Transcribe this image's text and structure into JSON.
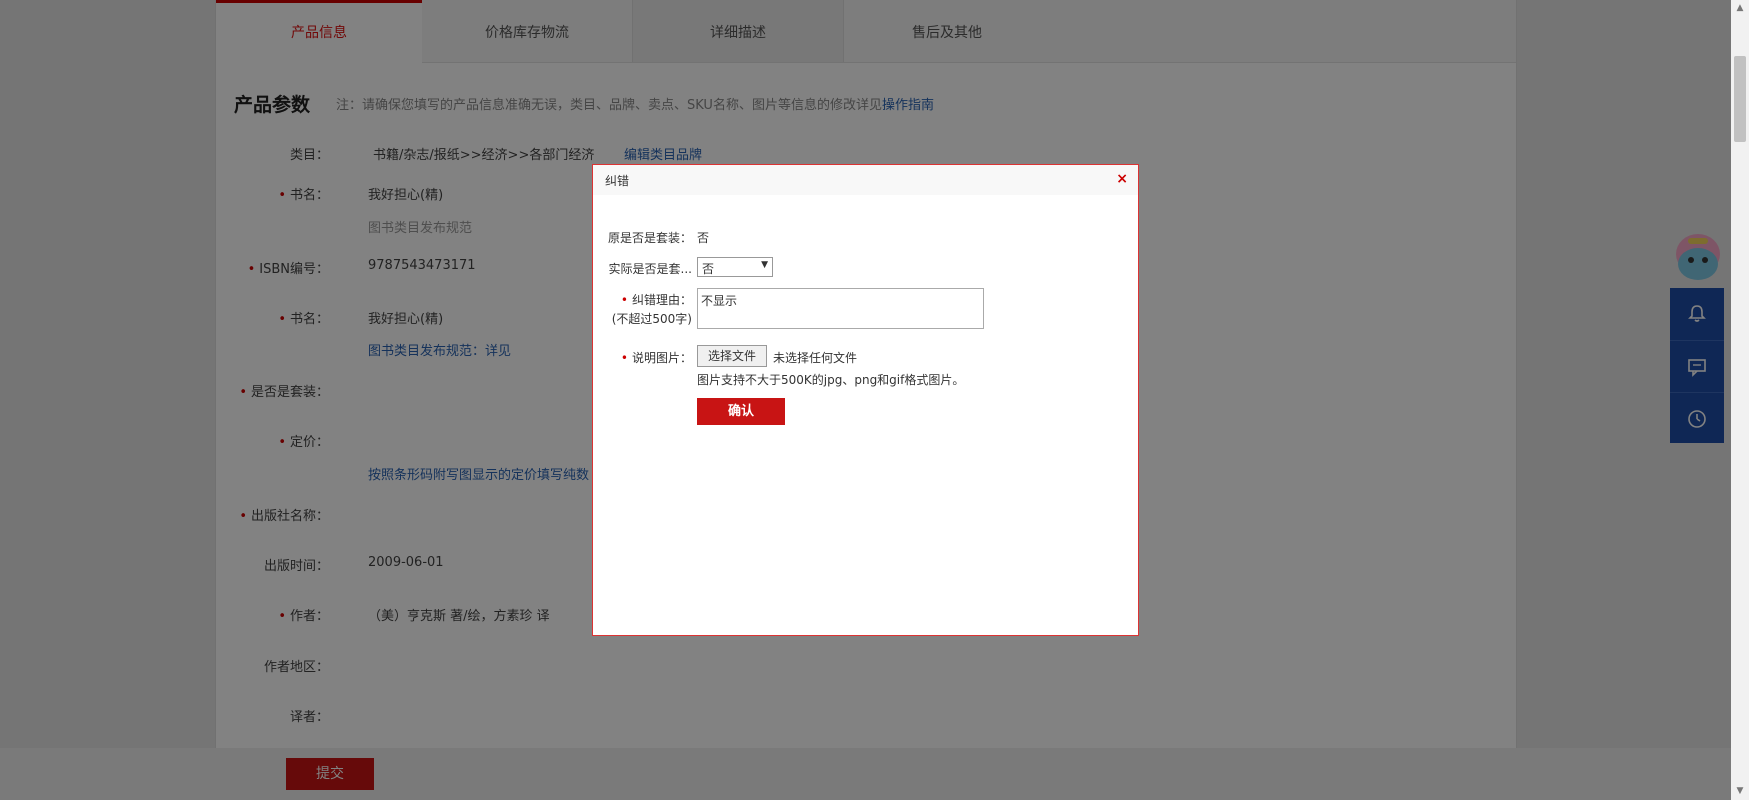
{
  "tabs": [
    {
      "label": "产品信息"
    },
    {
      "label": "价格库存物流"
    },
    {
      "label": "详细描述"
    },
    {
      "label": "售后及其他"
    }
  ],
  "section": {
    "title": "产品参数",
    "notice": "注：请确保您填写的产品信息准确无误，类目、品牌、卖点、SKU名称、图片等信息的修改详见",
    "notice_link": "操作指南"
  },
  "form": {
    "category_label": "类目：",
    "category_value": "书籍/杂志/报纸>>经济>>各部门经济",
    "category_edit_link": "编辑类目品牌",
    "bookname_label": "书名：",
    "bookname_value": "我好担心(精)",
    "bookname_hint": "图书类目发布规范",
    "isbn_label": "ISBN编号：",
    "isbn_value": "9787543473171",
    "bookname2_label": "书名：",
    "bookname2_value": "我好担心(精)",
    "bookname2_hint": "图书类目发布规范：详见",
    "is_set_label": "是否是套装：",
    "price_label": "定价：",
    "price_hint": "按照条形码附写图显示的定价填写纯数",
    "publisher_label": "出版社名称：",
    "pubdate_label": "出版时间：",
    "pubdate_value": "2009-06-01",
    "author_label": "作者：",
    "author_value": "（美）亨克斯  著/绘，方素珍  译",
    "author_region_label": "作者地区：",
    "translator_label": "译者："
  },
  "submit_label": "提交",
  "dialog": {
    "title": "纠错",
    "close": "×",
    "orig_set_label": "原是否是套装：",
    "orig_set_value": "否",
    "actual_set_label": "实际是否是套...",
    "actual_set_value": "否",
    "reason_label_1": "纠错理由：",
    "reason_label_2": "(不超过500字)",
    "reason_value": "不显示",
    "image_label": "说明图片：",
    "file_button": "选择文件",
    "file_status": "未选择任何文件",
    "file_hint": "图片支持不大于500K的jpg、png和gif格式图片。",
    "confirm": "确认"
  },
  "colors": {
    "accent": "#c81414",
    "link": "#2a63b3",
    "sidebar": "#1f4ea8"
  }
}
